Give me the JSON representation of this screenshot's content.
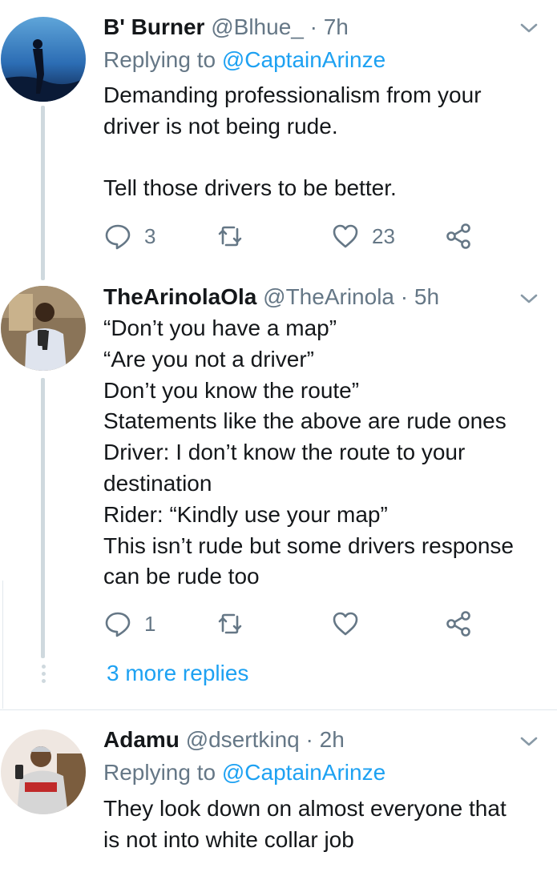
{
  "tweets": [
    {
      "name": "B' Burner",
      "handle": "@Blhue_",
      "dot": "·",
      "time": "7h",
      "reply_prefix": "Replying to",
      "reply_mention": "@CaptainArinze",
      "lines": [
        "Demanding professionalism from your",
        "driver is not being rude.",
        "",
        "Tell those drivers to be better."
      ],
      "reply_count": "3",
      "retweet_count": "",
      "like_count": "23"
    },
    {
      "name": "TheArinolaOla",
      "handle": "@TheArinola",
      "dot": "·",
      "time": "5h",
      "lines": [
        "“Don’t you have a map”",
        "“Are you not a driver”",
        "Don’t you know the route”",
        "Statements like the above are rude ones",
        "Driver: I don’t know the route to your",
        "destination",
        "Rider: “Kindly use your map”",
        "This isn’t rude but some drivers response",
        "can be rude too"
      ],
      "reply_count": "1",
      "retweet_count": "",
      "like_count": "",
      "more_replies": "3 more replies"
    },
    {
      "name": "Adamu",
      "handle": "@dsertkinq",
      "dot": "·",
      "time": "2h",
      "reply_prefix": "Replying to",
      "reply_mention": "@CaptainArinze",
      "lines": [
        "They look down on almost everyone that",
        "is not into white collar job"
      ]
    }
  ],
  "icons": {
    "reply": "reply-icon",
    "retweet": "retweet-icon",
    "like": "heart-icon",
    "share": "share-icon",
    "menu": "chevron-down-icon"
  },
  "colors": {
    "accent": "#1da1f2",
    "muted": "#657786",
    "text": "#14171a",
    "thread_line": "#cfd9de"
  }
}
